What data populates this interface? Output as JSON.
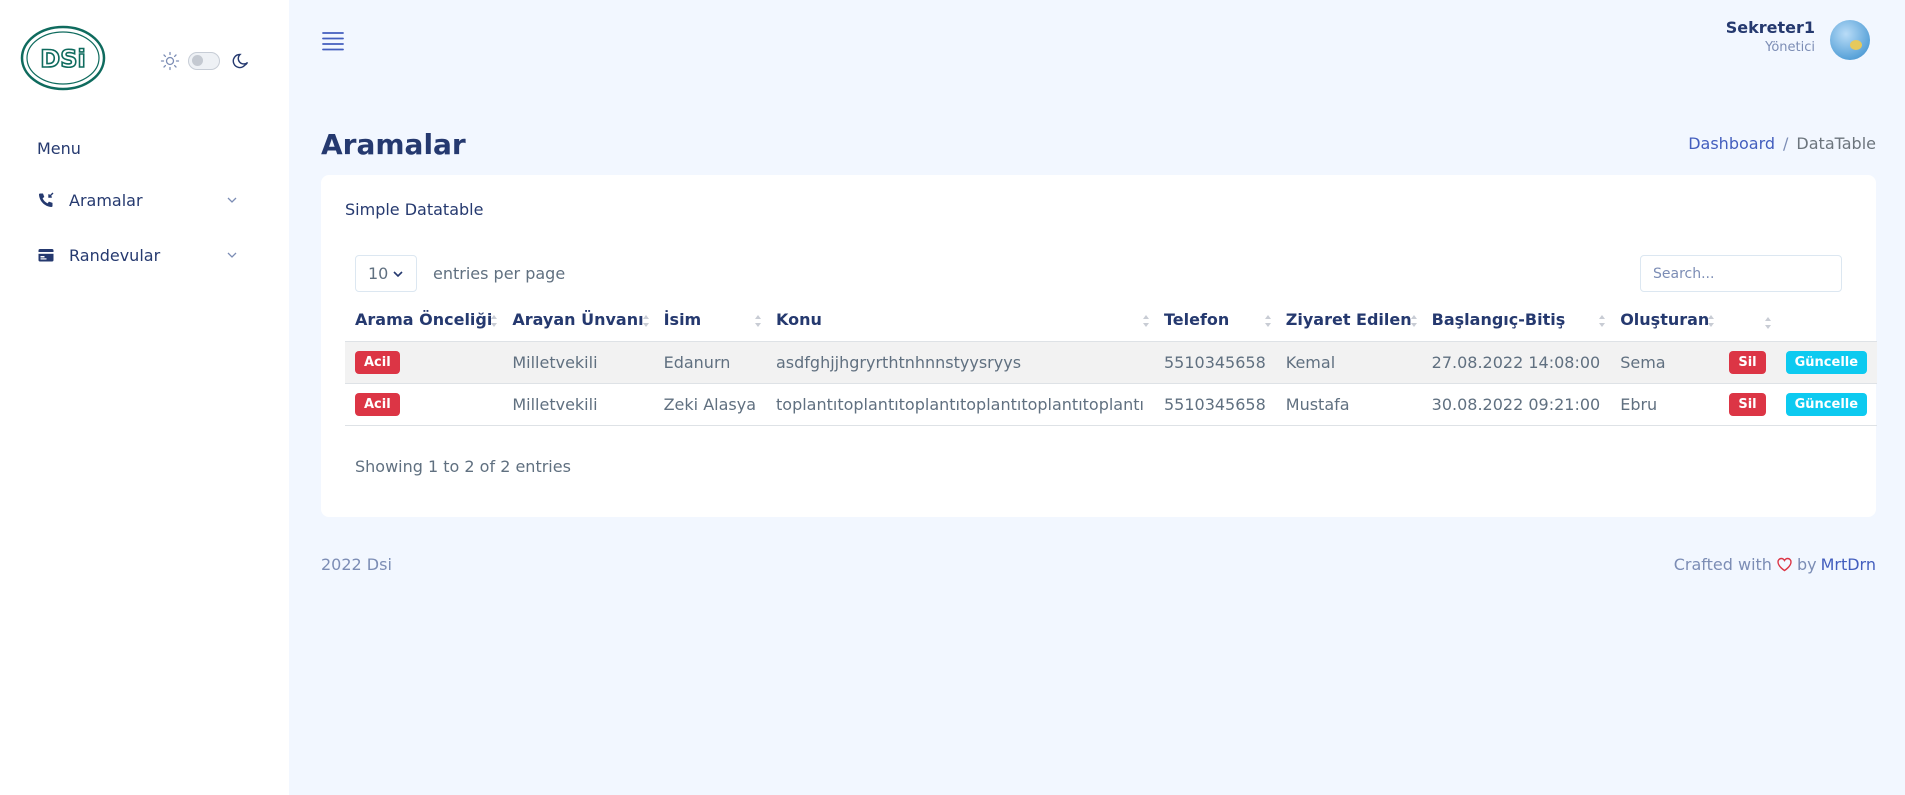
{
  "sidebar": {
    "logo_text": "DSi",
    "menu_title": "Menu",
    "items": [
      {
        "label": "Aramalar",
        "icon": "phone-incoming-icon"
      },
      {
        "label": "Randevular",
        "icon": "calendar-card-icon"
      }
    ]
  },
  "header": {
    "user_name": "Sekreter1",
    "user_role": "Yönetici"
  },
  "page": {
    "title": "Aramalar",
    "breadcrumb": [
      "Dashboard",
      "DataTable"
    ]
  },
  "card": {
    "title": "Simple Datatable",
    "per_page_value": "10",
    "per_page_label": "entries per page",
    "search_placeholder": "Search...",
    "columns": [
      "Arama Önceliği",
      "Arayan Ünvanı",
      "İsim",
      "Konu",
      "Telefon",
      "Ziyaret Edilen",
      "Başlangıç-Bitiş",
      "Oluşturan",
      ""
    ],
    "rows": [
      {
        "priority": "Acil",
        "title": "Milletvekili",
        "name": "Edanurn",
        "subject": "asdfghjjhgryrthtnhnnstyysryys",
        "phone": "5510345658",
        "visited": "Kemal",
        "datetime": "27.08.2022 14:08:00",
        "creator": "Sema",
        "delete_label": "Sil",
        "update_label": "Güncelle"
      },
      {
        "priority": "Acil",
        "title": "Milletvekili",
        "name": "Zeki Alasya",
        "subject": "toplantıtoplantıtoplantıtoplantıtoplantıtoplantı",
        "phone": "5510345658",
        "visited": "Mustafa",
        "datetime": "30.08.2022 09:21:00",
        "creator": "Ebru",
        "delete_label": "Sil",
        "update_label": "Güncelle"
      }
    ],
    "showing_text": "Showing 1 to 2 of 2 entries"
  },
  "footer": {
    "left": "2022 Dsi",
    "crafted": "Crafted with",
    "by": "by",
    "author": "MrtDrn"
  },
  "colors": {
    "primary": "#435ebe",
    "danger": "#dc3545",
    "info": "#0dcaf0",
    "heading": "#25396f",
    "background": "#f2f7ff"
  }
}
